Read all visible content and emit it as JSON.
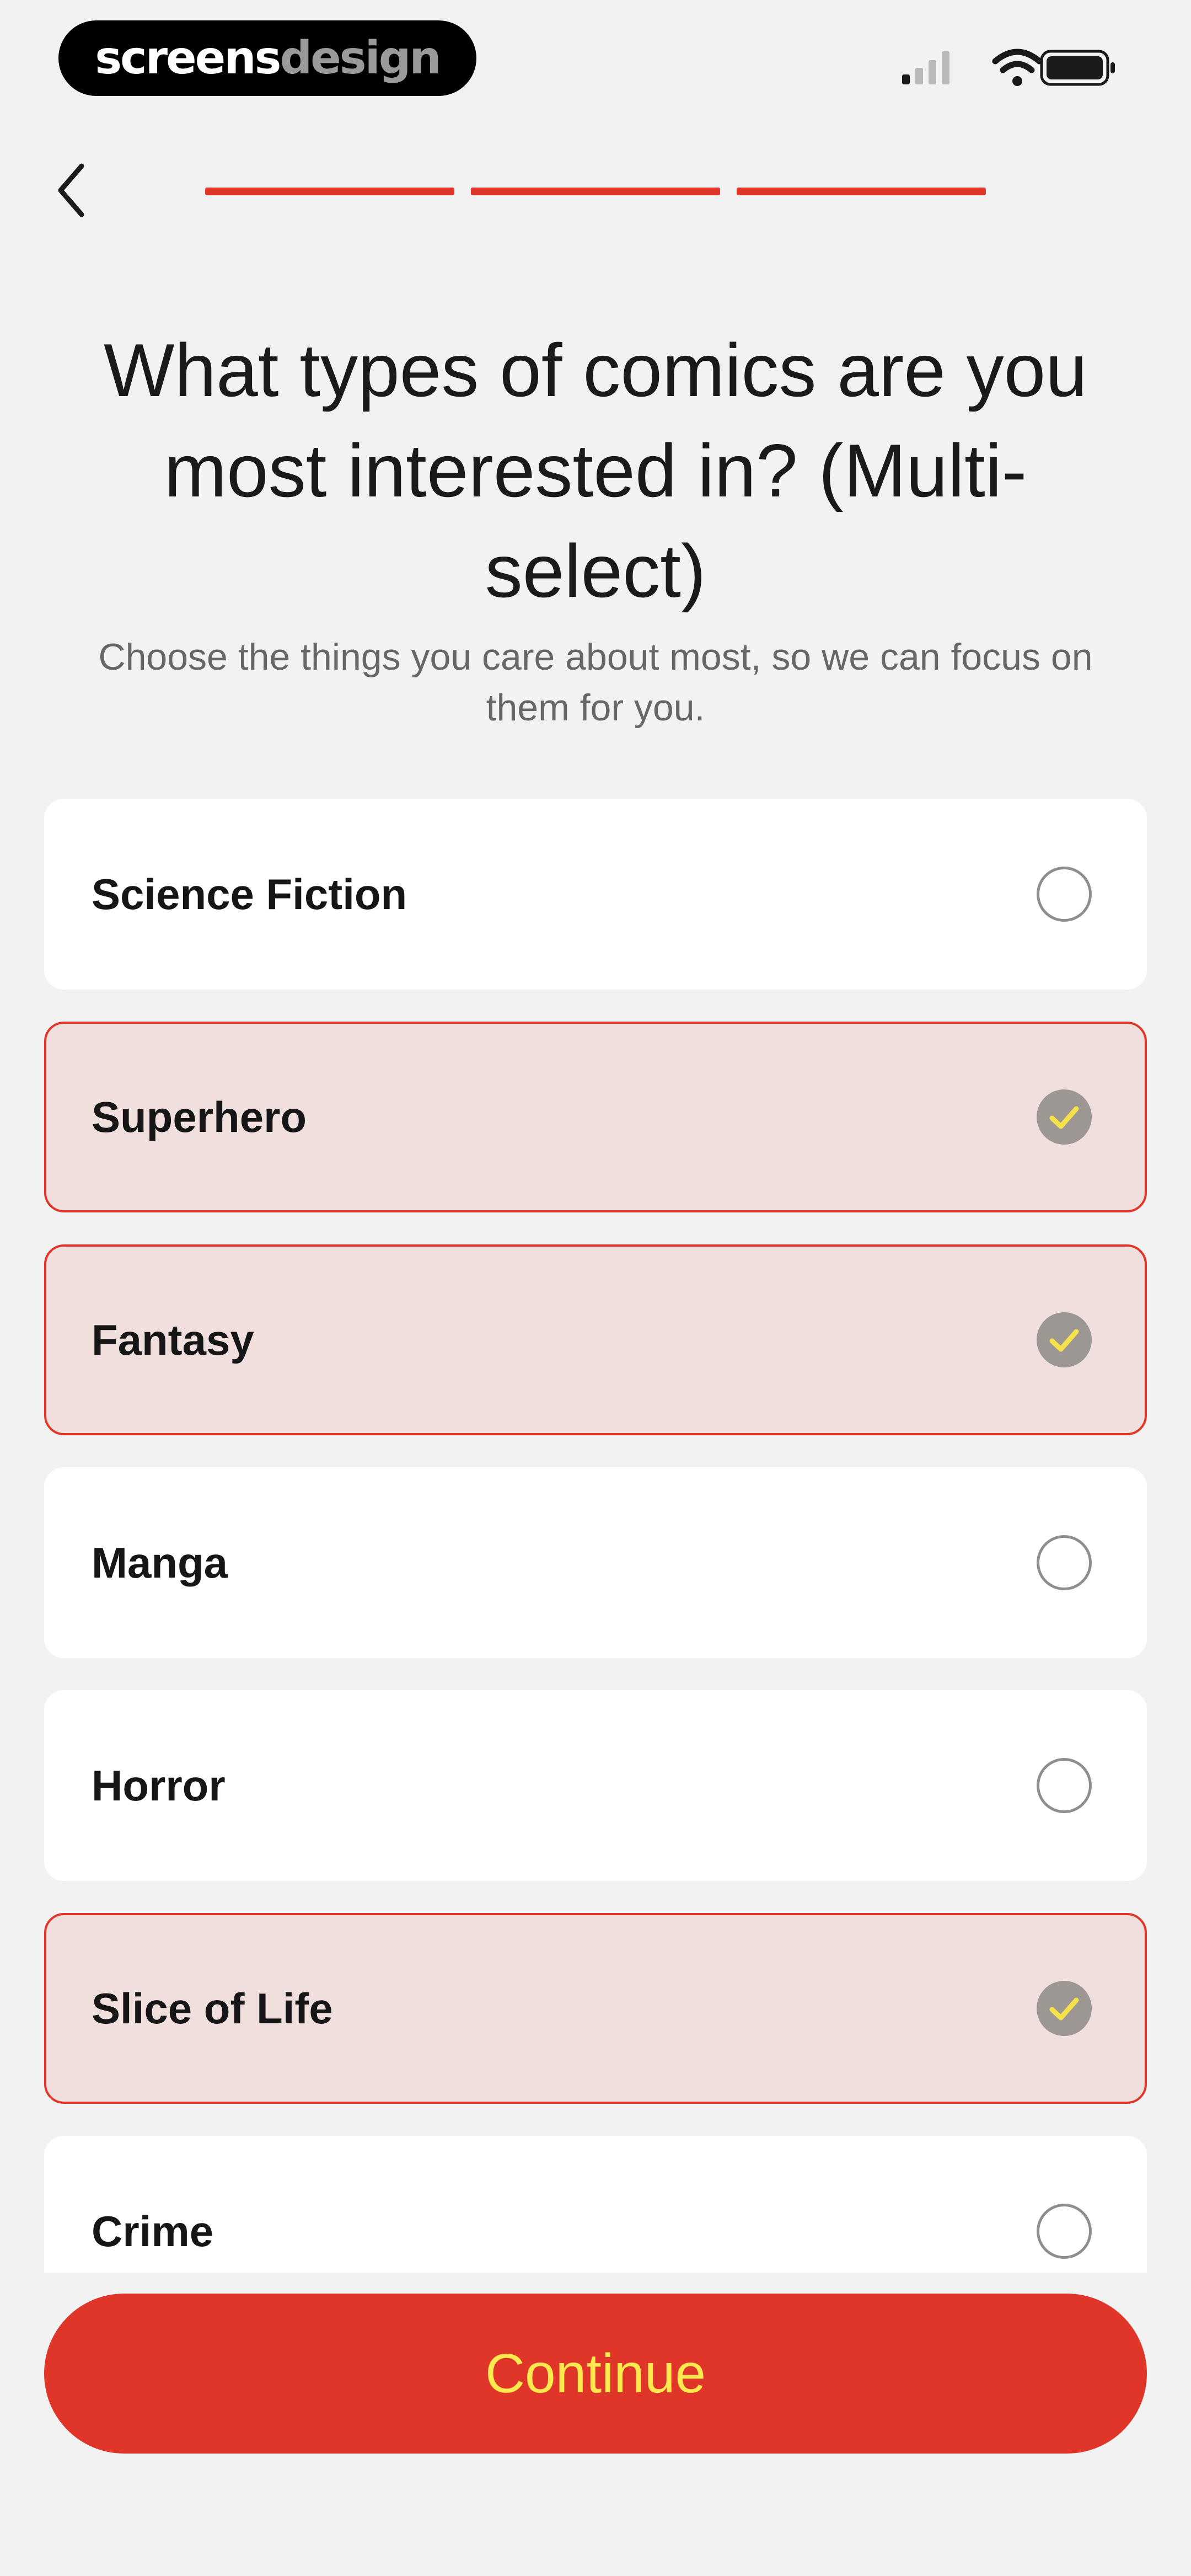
{
  "status_bar": {
    "brand_part1": "screens",
    "brand_part2": "design",
    "icons": [
      "cellular-signal-icon",
      "wifi-icon",
      "battery-icon"
    ]
  },
  "nav": {
    "back_icon": "chevron-left-icon",
    "progress_segments": 3,
    "progress_color": "#e0362a"
  },
  "header": {
    "title_lines": [
      "What types of comics are you",
      "most interested in? (Multi-",
      "select)"
    ],
    "subtitle_lines": [
      "Choose the things you care about most, so we can focus on",
      "them for you."
    ]
  },
  "options": [
    {
      "label": "Science Fiction",
      "selected": false
    },
    {
      "label": "Superhero",
      "selected": true
    },
    {
      "label": "Fantasy",
      "selected": true
    },
    {
      "label": "Manga",
      "selected": false
    },
    {
      "label": "Horror",
      "selected": false
    },
    {
      "label": "Slice of Life",
      "selected": true
    },
    {
      "label": "Crime",
      "selected": false
    }
  ],
  "footer": {
    "continue_label": "Continue"
  },
  "colors": {
    "accent": "#e0362a",
    "button_text": "#fde84e",
    "selected_bg": "#f0dfdc",
    "check_fill": "#9d9794",
    "check_mark": "#f5e14a"
  }
}
